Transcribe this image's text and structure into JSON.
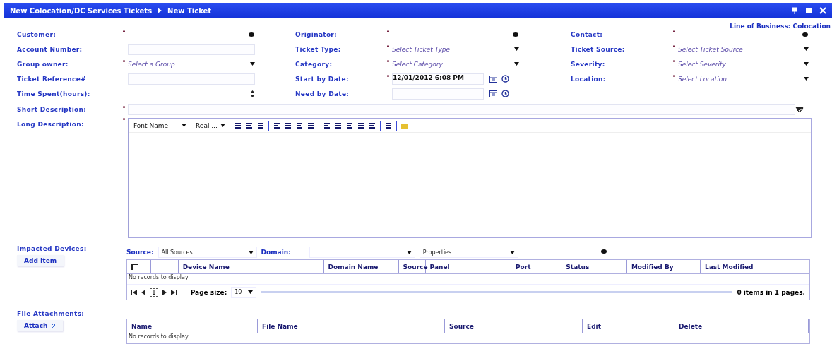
{
  "title_bar": {
    "breadcrumb": [
      "New Colocation/DC Services Tickets",
      "New Ticket"
    ]
  },
  "line_of_business": "Line of Business: Colocation",
  "field_columns": [
    [
      {
        "label": "Customer:",
        "required": true,
        "kind": "lookup"
      },
      {
        "label": "Account Number:",
        "required": false,
        "kind": "text"
      },
      {
        "label": "Group owner:",
        "required": true,
        "kind": "select",
        "placeholder": "Select a Group"
      },
      {
        "label": "Ticket Reference#",
        "required": false,
        "kind": "text"
      },
      {
        "label": "Time Spent(hours):",
        "required": false,
        "kind": "spin"
      }
    ],
    [
      {
        "label": "Originator:",
        "required": true,
        "kind": "lookup"
      },
      {
        "label": "Ticket Type:",
        "required": true,
        "kind": "select",
        "placeholder": "Select Ticket Type"
      },
      {
        "label": "Category:",
        "required": true,
        "kind": "select",
        "placeholder": "Select Category"
      },
      {
        "label": "Start by Date:",
        "required": true,
        "kind": "date",
        "value": "12/01/2012 6:08 PM"
      },
      {
        "label": "Need by Date:",
        "required": false,
        "kind": "date"
      }
    ],
    [
      {
        "label": "Contact:",
        "required": true,
        "kind": "lookup"
      },
      {
        "label": "Ticket Source:",
        "required": true,
        "kind": "select",
        "placeholder": "Select Ticket Source"
      },
      {
        "label": "Severity:",
        "required": true,
        "kind": "select",
        "placeholder": "Select Severity"
      },
      {
        "label": "Location:",
        "required": true,
        "kind": "select",
        "placeholder": "Select Location"
      }
    ]
  ],
  "short_description": {
    "label": "Short Description:",
    "required": true
  },
  "long_description": {
    "label": "Long Description:",
    "required": true,
    "font_name": "Font Name",
    "font_size": "Real ..."
  },
  "impacted_devices": {
    "label": "Impacted Devices:",
    "button": "Add Item",
    "source_label": "Source:",
    "source_value": "All Sources",
    "domain_label": "Domain:",
    "properties": "Properties",
    "select_all_checked": false,
    "columns": [
      "Device Name",
      "Domain Name",
      "Source",
      "Panel",
      "Port",
      "Status",
      "Modified By",
      "Last Modified"
    ],
    "empty_message": "No records to display",
    "current_page": "1",
    "page_size_label": "Page size:",
    "page_size": "10",
    "summary": "0 items in 1 pages."
  },
  "file_attachments": {
    "label": "File Attachments:",
    "button": "Attach",
    "columns": [
      "Name",
      "File Name",
      "Source",
      "Edit",
      "Delete"
    ],
    "empty_message": "No records to display"
  }
}
